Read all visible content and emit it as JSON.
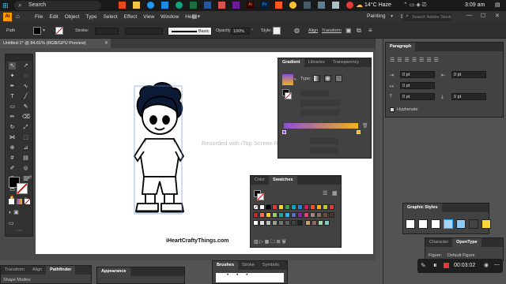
{
  "taskbar": {
    "search": "Search",
    "weather": "14°C  Haze",
    "time": "3:09 am"
  },
  "menu": {
    "items": [
      "File",
      "Edit",
      "Object",
      "Type",
      "Select",
      "Effect",
      "View",
      "Window",
      "Help"
    ],
    "workspace": "Painting",
    "search_placeholder": "Search Adobe Stock"
  },
  "control": {
    "object": "Path",
    "stroke_label": "Stroke:",
    "brush": "Basic",
    "opacity_label": "Opacity:",
    "opacity": "100%",
    "style_label": "Style:",
    "align": "Align",
    "transform": "Transform"
  },
  "document": {
    "tab_title": "Untitled-1* @ 84.61% (RGB/GPU Preview)"
  },
  "watermark": "Recorded with iTop Screen Recorder",
  "credit": "iHeartCraftyThings.com",
  "gradient_panel": {
    "tabs": [
      "Gradient",
      "Libraries",
      "Transparency"
    ],
    "type_label": "Type:",
    "colors": {
      "start": "#8a4fd8",
      "end": "#f2b21a"
    }
  },
  "swatches_panel": {
    "tabs": [
      "Color",
      "Swatches"
    ]
  },
  "paragraph_panel": {
    "title": "Paragraph",
    "values": [
      "0 pt",
      "0 pt",
      "0 pt",
      "0 pt",
      "0 pt"
    ],
    "hyphenate": "Hyphenate"
  },
  "graphic_styles": {
    "title": "Graphic Styles"
  },
  "character_panel": {
    "tabs": [
      "Character",
      "OpenType"
    ],
    "figure_label": "Figure:",
    "figure_value": "Default Figure"
  },
  "recorder": {
    "time": "00:03:02"
  },
  "bottom_panels": {
    "left_tabs": [
      "Transform",
      "Align",
      "Pathfinder"
    ],
    "shape_modes": "Shape Modes:",
    "appearance": "Appearance",
    "brushes_tabs": [
      "Brushes",
      "Stroke",
      "Symbols"
    ]
  },
  "accent": "#31a8ff"
}
